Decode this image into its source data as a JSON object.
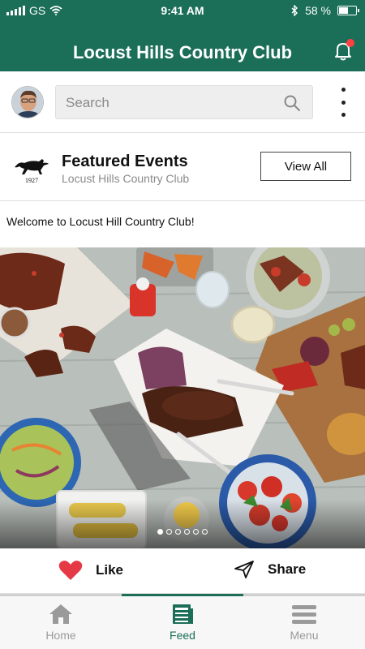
{
  "status_bar": {
    "carrier": "GS",
    "time": "9:41 AM",
    "battery_percent": "58 %",
    "battery_level": 0.58
  },
  "header": {
    "title": "Locust Hills Country Club",
    "has_notification": true
  },
  "search": {
    "placeholder": "Search"
  },
  "featured": {
    "title": "Featured Events",
    "subtitle": "Locust Hills Country Club",
    "view_all_label": "View All",
    "logo_year": "1927"
  },
  "post": {
    "text": "Welcome to Locust Hill Country Club!",
    "carousel": {
      "total": 6,
      "active_index": 0
    }
  },
  "actions": {
    "like_label": "Like",
    "share_label": "Share"
  },
  "tabs": [
    {
      "label": "Home",
      "icon": "home-icon",
      "active": false
    },
    {
      "label": "Feed",
      "icon": "feed-icon",
      "active": true
    },
    {
      "label": "Menu",
      "icon": "menu-icon",
      "active": false
    }
  ],
  "colors": {
    "brand": "#1b6e57",
    "like": "#e63946",
    "notification": "#ff4040"
  }
}
